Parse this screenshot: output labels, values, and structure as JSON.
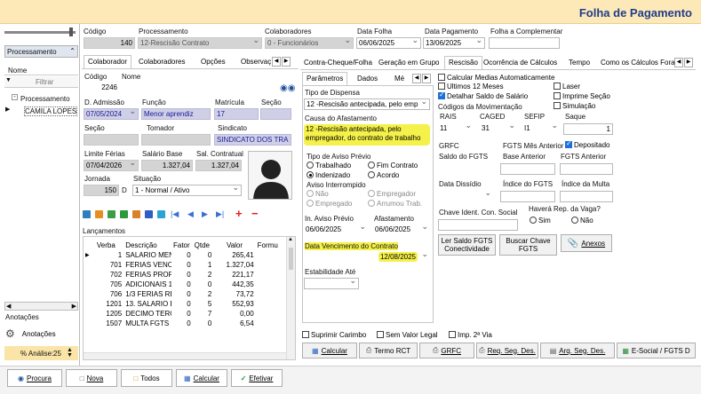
{
  "app": {
    "title": "Folha de Pagamento"
  },
  "header": {
    "codigo_label": "Código",
    "codigo_value": "140",
    "processamento_label": "Processamento",
    "processamento_value": "12-Rescisão Contrato",
    "colaboradores_label": "Colaboradores",
    "colaboradores_value": "0 - Funcionários",
    "data_folha_label": "Data Folha",
    "data_folha_value": "06/06/2025",
    "data_pagamento_label": "Data Pagamento",
    "data_pagamento_value": "13/06/2025",
    "folha_complementar_label": "Folha a Complementar"
  },
  "left_panel": {
    "processamento_label": "Processamento",
    "nome_header": "Nome",
    "filtrar_placeholder": "Filtrar",
    "tree_item": "Processamento",
    "list_item": "CAMILA LOPES",
    "anotacoes_label": "Anotações",
    "anotacoes_button": "Anotações",
    "analise_label": "% Análise:",
    "analise_value": "25"
  },
  "mid_tabs": [
    "Colaborador",
    "Colaboradores",
    "Opções",
    "Observaç"
  ],
  "colaborador": {
    "codigo_label": "Código",
    "nome_label": "Nome",
    "codigo_value": "2246",
    "admissao_label": "D. Admissão",
    "admissao_value": "07/05/2024",
    "funcao_label": "Função",
    "funcao_value": "Menor aprendiz",
    "matricula_label": "Matrícula",
    "matricula_value": "17",
    "secao_label": "Seção",
    "secao2_label": "Seção",
    "tomador_label": "Tomador",
    "sindicato_label": "Sindicato",
    "sindicato_value": "SINDICATO DOS TRA",
    "limite_ferias_label": "Limite Férias",
    "limite_ferias_value": "07/04/2026",
    "salario_base_label": "Salário Base",
    "salario_base_value": "1.327,04",
    "sal_contratual_label": "Sal. Contratual",
    "sal_contratual_value": "1.327,04",
    "jornada_label": "Jornada",
    "jornada_value": "150",
    "jornada_unit": "D",
    "situacao_label": "Situação",
    "situacao_value": "1 - Normal / Ativo"
  },
  "lancamentos": {
    "title": "Lançamentos",
    "columns": [
      "Verba",
      "Descrição",
      "Fator",
      "Qtde",
      "Valor",
      "Formu"
    ],
    "rows": [
      [
        "1",
        "SALARIO MENS",
        "0",
        "0",
        "265,41"
      ],
      [
        "701",
        "FERIAS VENCID",
        "0",
        "1",
        "1.327,04"
      ],
      [
        "702",
        "FERIAS PROPO",
        "0",
        "2",
        "221,17"
      ],
      [
        "705",
        "ADICIONAIS 1/3",
        "0",
        "0",
        "442,35"
      ],
      [
        "706",
        "1/3 FERIAS RES",
        "0",
        "2",
        "73,72"
      ],
      [
        "1201",
        "13. SALARIO EN",
        "0",
        "5",
        "552,93"
      ],
      [
        "1205",
        "DECIMO TERC.",
        "0",
        "7",
        "0,00"
      ],
      [
        "1507",
        "MULTA FGTS",
        "0",
        "0",
        "6,54"
      ]
    ]
  },
  "right_tabs": [
    "Contra-Cheque/Folha",
    "Geração em Grupo",
    "Rescisão",
    "Ocorrência de Cálculos",
    "Tempo",
    "Como os Cálculos Fora"
  ],
  "sub_tabs": [
    "Parâmetros",
    "Dados",
    "Mé"
  ],
  "rescisao": {
    "tipo_dispensa_label": "Tipo de Dispensa",
    "tipo_dispensa_value": "12 -Rescisão antecipada, pelo emp",
    "causa_label": "Causa do Afastamento",
    "causa_value": "12 -Rescisão antecipada, pelo empregador, do contrato de trabalho",
    "aviso_previo_label": "Tipo de Aviso Prévio",
    "aviso_opts": [
      "Trabalhado",
      "Fim Contrato",
      "Indenizado",
      "Acordo"
    ],
    "aviso_interrompido_label": "Aviso Interrompido",
    "interrompido_opts": [
      "Não",
      "Empregador",
      "Empregado",
      "Arrumou Trab."
    ],
    "inicio_aviso_label": "In. Aviso Prévio",
    "inicio_aviso_value": "06/06/2025",
    "afastamento_label": "Afastamento",
    "afastamento_value": "06/06/2025",
    "vencimento_label": "Data Vencimento do Contrato",
    "vencimento_value": "12/08/2025",
    "estabilidade_label": "Estabilidade Até"
  },
  "opcoes": {
    "calc_medias": "Calcular Medias Automaticamente",
    "ultimos12": "Ultimos 12 Meses",
    "laser": "Laser",
    "detalhar_saldo": "Detalhar Saldo de Salário",
    "imprime_secao": "Imprime Seção",
    "codigos_mov": "Códigos da Movimentação",
    "simulacao": "Simulação",
    "rais_label": "RAIS",
    "caged_label": "CAGED",
    "sefip_label": "SEFIP",
    "saque_label": "Saque",
    "rais_value": "11",
    "caged_value": "31",
    "sefip_value": "I1",
    "saque_value": "1",
    "grfc_label": "GRFC",
    "fgts_mes_anterior_label": "FGTS Mês Anterior",
    "depositado_label": "Depositado",
    "saldo_fgts_label": "Saldo do FGTS",
    "base_anterior_label": "Base Anterior",
    "fgts_anterior_label": "FGTS Anterior",
    "data_dissidio_label": "Data Dissídio",
    "indice_fgts_label": "Índice do FGTS",
    "indice_multa_label": "Índice da Multa",
    "chave_label": "Chave Ident. Con. Social",
    "havera_label": "Haverá Rep. da Vaga?",
    "sim": "Sim",
    "nao": "Não",
    "ler_saldo_button": "Ler Saldo FGTS Conectividade",
    "buscar_chave_button": "Buscar Chave FGTS",
    "anexos_button": "Anexos"
  },
  "bottom_checks": {
    "suprimir_carimbo": "Suprimir Carimbo",
    "sem_valor_legal": "Sem Valor Legal",
    "imp_2via": "Imp. 2ª Via"
  },
  "action_buttons": [
    "Calcular",
    "Termo RCT",
    "GRFC",
    "Req. Seg. Des.",
    "Arq. Seg. Des.",
    "E-Social / FGTS D"
  ],
  "footer": {
    "procura": "Procura",
    "nova": "Nova",
    "todos": "Todos",
    "calcular": "Calcular",
    "efetivar": "Efetivar"
  },
  "colors": {
    "title_bar": "#fde8b7",
    "title_text": "#1f3d8a",
    "highlight": "#f4f14a",
    "lav_field": "#cfcfe6"
  }
}
